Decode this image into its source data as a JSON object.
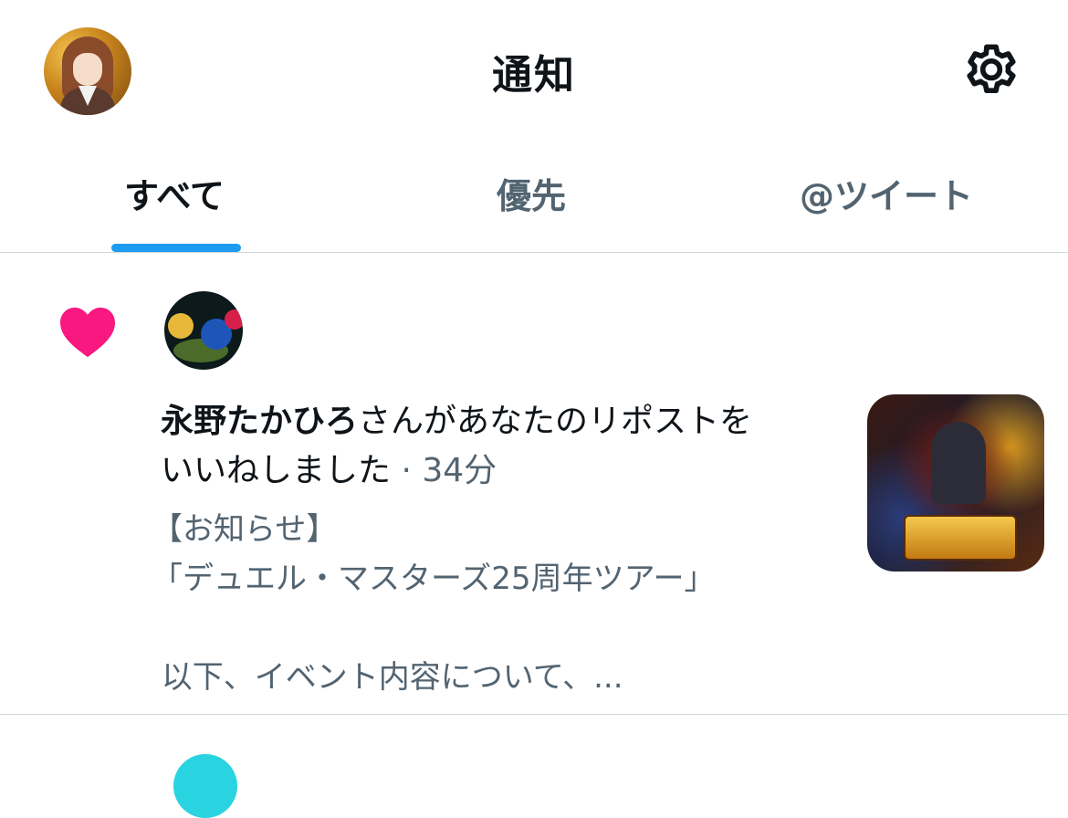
{
  "header": {
    "title": "通知",
    "avatar_icon": "user-avatar",
    "settings_icon": "gear-icon"
  },
  "tabs": [
    {
      "label": "すべて",
      "active": true
    },
    {
      "label": "優先",
      "active": false
    },
    {
      "label": "@ツイート",
      "active": false
    }
  ],
  "notification": {
    "type_icon": "heart-icon",
    "user_name": "永野たかひろ",
    "action_text_line1": "さんがあなたのリポストを",
    "action_text_line2": "いいねしました",
    "time": " · 34分",
    "post_lines": [
      "【お知らせ】",
      "「デュエル・マスターズ25周年ツアー」",
      " 以下、イベント内容について、..."
    ]
  },
  "colors": {
    "accent": "#1d9bf0",
    "like": "#f91880",
    "text_primary": "#0f1419",
    "text_secondary": "#536471",
    "divider": "#cfd9de"
  }
}
